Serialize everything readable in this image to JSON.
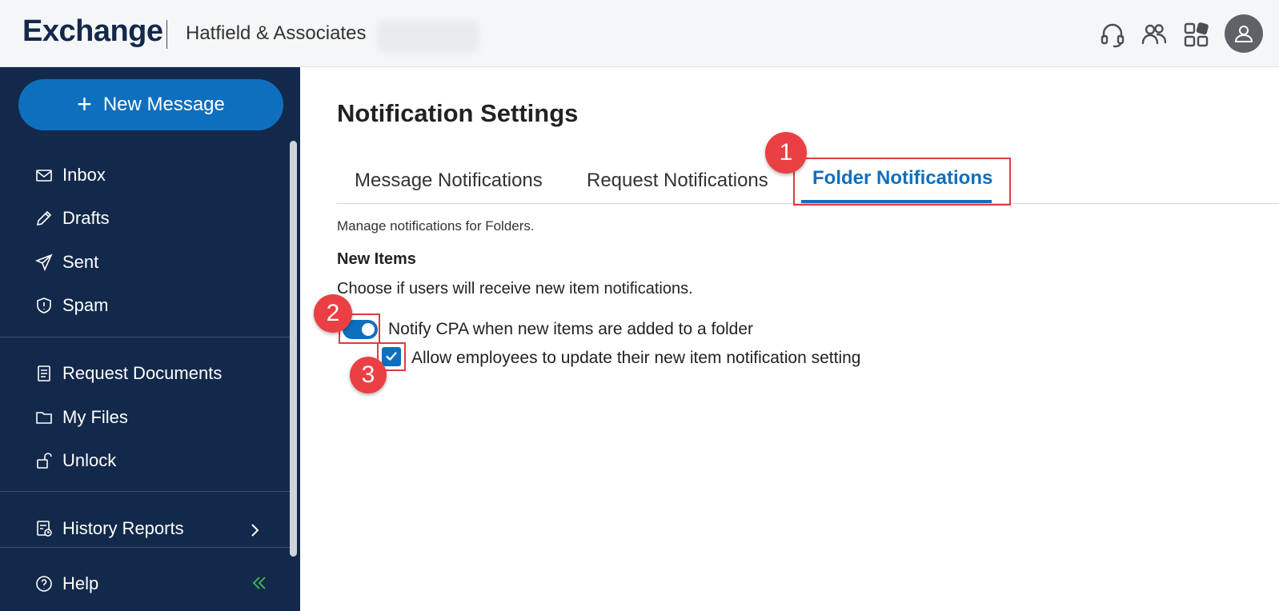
{
  "header": {
    "brand": "Exchange",
    "firm": "Hatfield & Associates"
  },
  "sidebar": {
    "new_message": "New Message",
    "items": [
      {
        "label": "Inbox",
        "icon": "mail-icon"
      },
      {
        "label": "Drafts",
        "icon": "pencil-icon"
      },
      {
        "label": "Sent",
        "icon": "send-icon"
      },
      {
        "label": "Spam",
        "icon": "shield-icon"
      },
      {
        "label": "Request Documents",
        "icon": "document-icon"
      },
      {
        "label": "My Files",
        "icon": "folder-icon"
      },
      {
        "label": "Unlock",
        "icon": "unlock-icon"
      },
      {
        "label": "History Reports",
        "icon": "report-icon"
      },
      {
        "label": "Help",
        "icon": "help-icon"
      }
    ]
  },
  "main": {
    "title": "Notification Settings",
    "tabs": [
      {
        "label": "Message Notifications",
        "active": false
      },
      {
        "label": "Request Notifications",
        "active": false
      },
      {
        "label": "Folder Notifications",
        "active": true
      }
    ],
    "description": "Manage notifications for Folders.",
    "section_title": "New Items",
    "section_desc": "Choose if users will receive new item notifications.",
    "toggle_label": "Notify CPA when new items are added to a folder",
    "toggle_on": true,
    "checkbox_label": "Allow employees to update their new item notification setting",
    "checkbox_checked": true
  },
  "callouts": [
    "1",
    "2",
    "3"
  ],
  "colors": {
    "brand_navy": "#13294b",
    "accent_blue": "#0e6fbe",
    "callout_red": "#ea4043"
  }
}
